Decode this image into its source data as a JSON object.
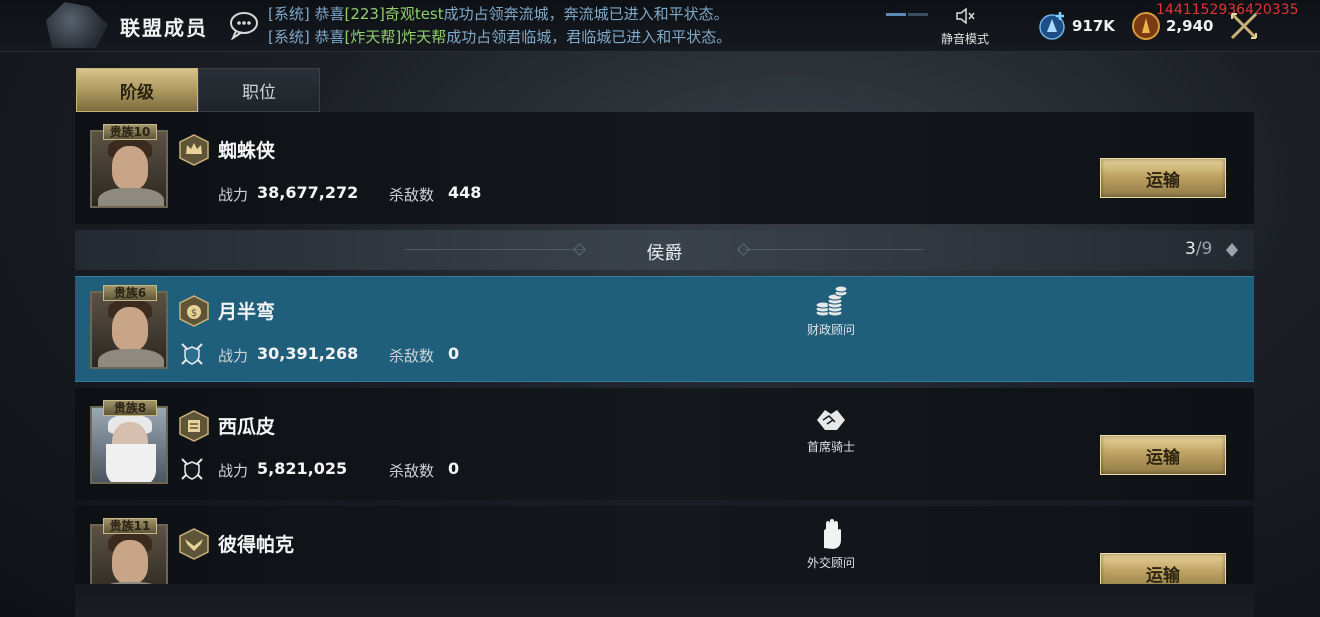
{
  "header": {
    "title": "联盟成员",
    "chat": [
      {
        "sys": "[系统] 恭喜",
        "highlight": "[223]奇观test",
        "text": "成功占领奔流城，奔流城已进入和平状态。"
      },
      {
        "sys": "[系统] 恭喜",
        "highlight": "[炸天帮]炸天帮",
        "text": "成功占领君临城，君临城已进入和平状态。"
      }
    ],
    "mute_label": "静音模式",
    "crystal": "917K",
    "gold": "2,940",
    "user_id": "1441152936420335"
  },
  "tabs": [
    {
      "label": "阶级",
      "active": true
    },
    {
      "label": "职位",
      "active": false
    }
  ],
  "labels": {
    "power": "战力",
    "kills": "杀敌数",
    "transport": "运输"
  },
  "leader": {
    "rank": "贵族10",
    "name": "蜘蛛侠",
    "power": "38,677,272",
    "kills": "448"
  },
  "section": {
    "title": "侯爵",
    "count": "3",
    "max": "/9"
  },
  "members": [
    {
      "rank": "贵族6",
      "name": "月半弯",
      "power": "30,391,268",
      "kills": "0",
      "duty": "财政顾问",
      "duty_icon": "coins-icon",
      "selected": true
    },
    {
      "rank": "贵族8",
      "name": "西瓜皮",
      "power": "5,821,025",
      "kills": "0",
      "duty": "首席骑士",
      "duty_icon": "handshake-icon",
      "selected": false
    },
    {
      "rank": "贵族11",
      "name": "彼得帕克",
      "duty": "外交顾问",
      "duty_icon": "hand-icon",
      "selected": false
    }
  ]
}
